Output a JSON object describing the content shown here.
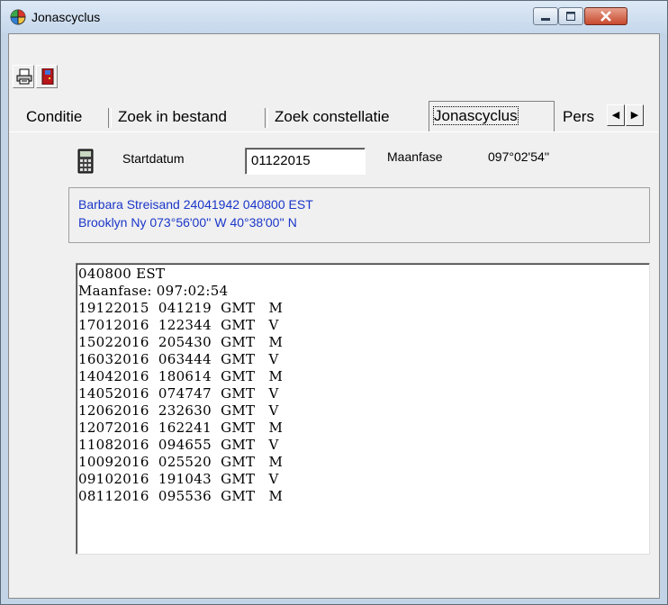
{
  "window": {
    "title": "Jonascyclus"
  },
  "toolbar": {
    "buttons": [
      {
        "icon": "printer-icon"
      },
      {
        "icon": "exit-door-icon"
      }
    ]
  },
  "tabs": [
    {
      "label": "Conditie"
    },
    {
      "label": "Zoek in bestand"
    },
    {
      "label": "Zoek constellatie"
    },
    {
      "label": "Jonascyclus",
      "active": true
    },
    {
      "label": "Pers"
    }
  ],
  "form": {
    "start_label": "Startdatum",
    "start_value": "01122015",
    "moon_label": "Maanfase",
    "moon_value": "097°02'54''"
  },
  "info": {
    "line1": "Barbara Streisand 24041942 040800 EST",
    "line2": "Brooklyn Ny 073°56'00'' W 40°38'00'' N"
  },
  "output": {
    "lines": [
      "040800 EST",
      "Maanfase: 097:02:54",
      "19122015  041219  GMT   M",
      "17012016  122344  GMT   V",
      "15022016  205430  GMT   M",
      "16032016  063444  GMT   V",
      "14042016  180614  GMT   M",
      "14052016  074747  GMT   V",
      "12062016  232630  GMT   V",
      "12072016  162241  GMT   M",
      "11082016  094655  GMT   V",
      "10092016  025520  GMT   M",
      "09102016  191043  GMT   V",
      "08112016  095536  GMT   M"
    ]
  },
  "colors": {
    "info_text": "#1a36c9",
    "close_button": "#c7492d"
  }
}
